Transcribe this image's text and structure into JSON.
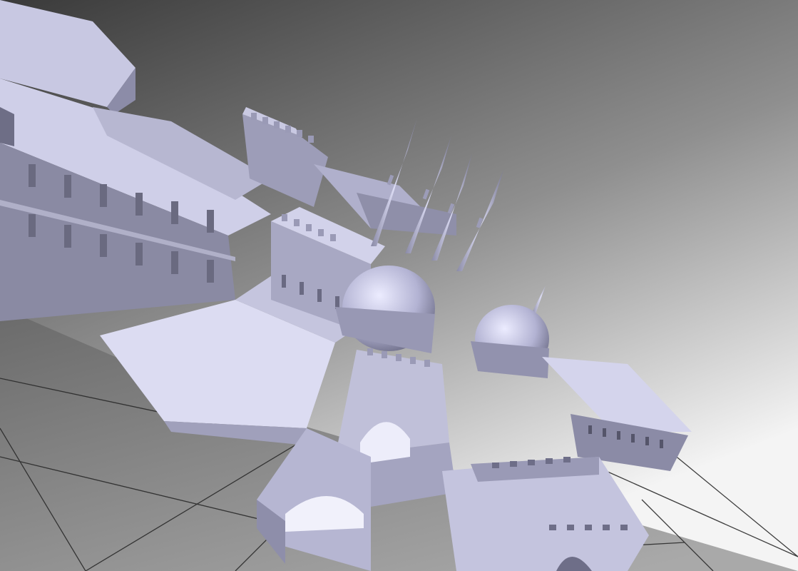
{
  "scene": {
    "subject": "untextured-3d-model-fortress-with-domes-and-minarets",
    "render_style": "flat-shaded-gray-viewport",
    "colors": {
      "background_top": "#3c3c3c",
      "background_bottom": "#f2f2f2",
      "ground": "#8a8a8a",
      "ground_grid_line": "#2a2a2a",
      "model_light": "#d9d9f2",
      "model_mid": "#b4b4d0",
      "model_dark": "#77778f",
      "model_shadow": "#4a4a5a"
    }
  }
}
